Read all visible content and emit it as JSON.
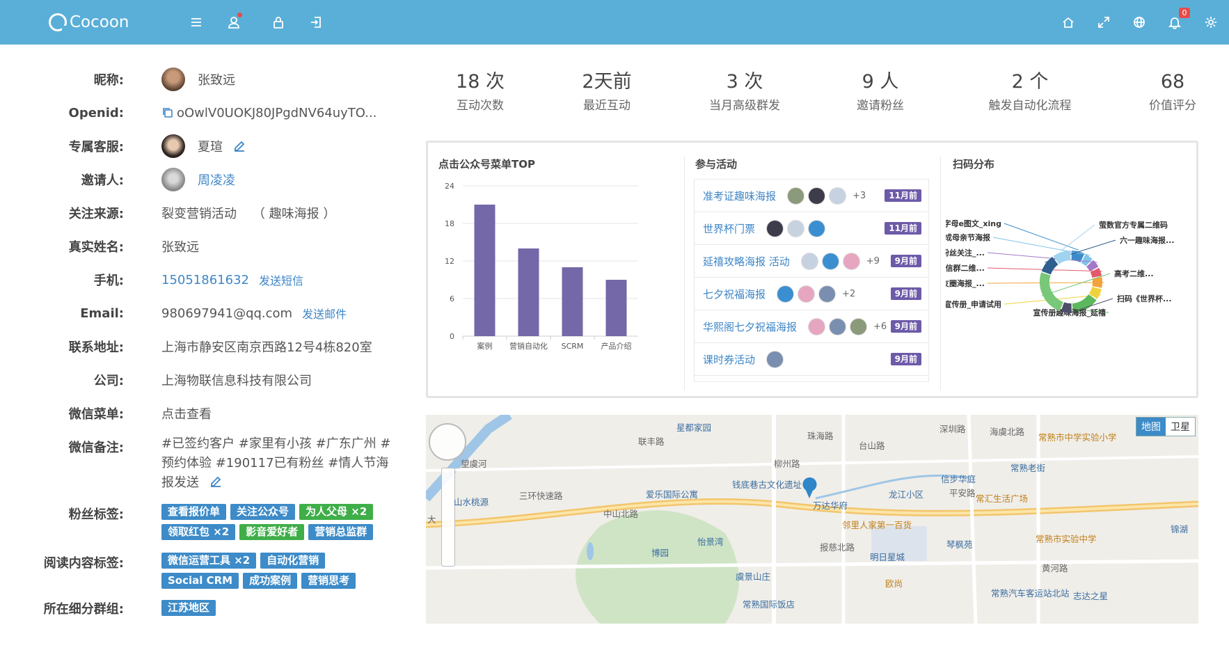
{
  "app": {
    "brand": "Cocoon",
    "notification_count": "0"
  },
  "topbar": {
    "left_icons": [
      "menu-icon",
      "user-icon",
      "lock-icon",
      "logout-icon"
    ],
    "right_icons": [
      "home-icon",
      "fullscreen-icon",
      "globe-icon",
      "bell-icon",
      "gear-icon"
    ],
    "accent": "#5aafd8"
  },
  "profile": {
    "nickname_label": "昵称:",
    "nickname": "张致远",
    "openid_label": "Openid:",
    "openid": "oOwlV0UOKJ80JPgdNV64uyTO...",
    "agent_label": "专属客服:",
    "agent": "夏瑄",
    "inviter_label": "邀请人:",
    "inviter": "周凌凌",
    "source_label": "关注来源:",
    "source": "裂变营销活动    （ 趣味海报 ）",
    "realname_label": "真实姓名:",
    "realname": "张致远",
    "phone_label": "手机:",
    "phone": "15051861632",
    "send_sms": "发送短信",
    "email_label": "Email:",
    "email": "980697941@qq.com",
    "send_mail": "发送邮件",
    "address_label": "联系地址:",
    "address": "上海市静安区南京西路12号4栋820室",
    "company_label": "公司:",
    "company": "上海物联信息科技有限公司",
    "wxmenu_label": "微信菜单:",
    "wxmenu": "点击查看",
    "wxnote_label": "微信备注:",
    "wxnote": "#已签约客户 #家里有小孩 #广东广州 #预约体验 #190117已有粉丝 #情人节海报发送",
    "fan_tags_label": "粉丝标签:",
    "fan_tags": [
      {
        "text": "查看报价单",
        "color": "blue"
      },
      {
        "text": "关注公众号",
        "color": "blue"
      },
      {
        "text": "为人父母  ×2",
        "color": "green"
      },
      {
        "text": "领取红包  ×2",
        "color": "blue"
      },
      {
        "text": "影音爱好者",
        "color": "green"
      },
      {
        "text": "营销总监群",
        "color": "blue"
      }
    ],
    "read_tags_label": "阅读内容标签:",
    "read_tags": [
      {
        "text": "微信运营工具  ×2",
        "color": "blue"
      },
      {
        "text": "自动化营销",
        "color": "blue"
      },
      {
        "text": "Social CRM",
        "color": "blue"
      },
      {
        "text": "成功案例",
        "color": "blue"
      },
      {
        "text": "营销思考",
        "color": "blue"
      }
    ],
    "segment_label": "所在细分群组:",
    "segments": [
      {
        "text": "江苏地区",
        "color": "blue"
      }
    ]
  },
  "stats": [
    {
      "value": "18 次",
      "caption": "互动次数"
    },
    {
      "value": "2天前",
      "caption": "最近互动"
    },
    {
      "value": "3 次",
      "caption": "当月高级群发"
    },
    {
      "value": "9 人",
      "caption": "邀请粉丝"
    },
    {
      "value": "2 个",
      "caption": "触发自动化流程"
    },
    {
      "value": "68",
      "caption": "价值评分"
    }
  ],
  "panel": {
    "menu_title": "点击公众号菜单TOP",
    "activity_title": "参与活动",
    "scan_title": "扫码分布"
  },
  "chart_data": [
    {
      "type": "bar",
      "title": "点击公众号菜单TOP",
      "categories": [
        "案例",
        "营销自动化",
        "SCRM",
        "产品介绍"
      ],
      "values": [
        21,
        14,
        11,
        9
      ],
      "ylim": [
        0,
        24
      ],
      "yticks": [
        0,
        6,
        12,
        18,
        24
      ],
      "xlabel": "",
      "ylabel": "",
      "grid": true,
      "color": "#7468a8"
    },
    {
      "type": "pie",
      "title": "扫码分布",
      "labels": [
        "海报字母e图文_xing",
        "生成母亲节海报",
        "新粉丝关注_...",
        "微信群二维...",
        "朋友圈海报_...",
        "萤宣传册_申请试用",
        "宣传册趣味海报_延禧",
        "扫码《世界杯...",
        "高考二维...",
        "六一趣味海报...",
        "萤数官方专属二维码"
      ],
      "values": [
        6,
        4,
        4,
        4,
        5,
        5,
        12,
        5,
        20,
        8,
        8
      ]
    }
  ],
  "activities": [
    {
      "name": "准考证趣味海报",
      "extra": "+3",
      "when": "11月前",
      "avatars": 3
    },
    {
      "name": "世界杯门票",
      "extra": "",
      "when": "11月前",
      "avatars": 3
    },
    {
      "name": "延禧攻略海报 活动",
      "extra": "+9",
      "when": "9月前",
      "avatars": 3
    },
    {
      "name": "七夕祝福海报",
      "extra": "+2",
      "when": "9月前",
      "avatars": 3
    },
    {
      "name": "华熙阁七夕祝福海报",
      "extra": "+6",
      "when": "9月前",
      "avatars": 3
    },
    {
      "name": "课时券活动",
      "extra": "",
      "when": "9月前",
      "avatars": 1
    }
  ],
  "map": {
    "toggle_map": "地图",
    "toggle_sat": "卫星",
    "labels": [
      {
        "t": "星都家园",
        "k": "poi"
      },
      {
        "t": "联丰路",
        "k": "road"
      },
      {
        "t": "珠海路",
        "k": "road"
      },
      {
        "t": "台山路",
        "k": "road"
      },
      {
        "t": "深圳路",
        "k": "road"
      },
      {
        "t": "海虞北路",
        "k": "road"
      },
      {
        "t": "常熟市中学实验小学",
        "k": "orange"
      },
      {
        "t": "常熟老街",
        "k": "poi"
      },
      {
        "t": "信步华庭",
        "k": "poi"
      },
      {
        "t": "平安路",
        "k": "road"
      },
      {
        "t": "常汇生活广场",
        "k": "orange"
      },
      {
        "t": "龙江小区",
        "k": "poi"
      },
      {
        "t": "万达华府",
        "k": "poi"
      },
      {
        "t": "钱底巷古文化遗址",
        "k": "poi"
      },
      {
        "t": "爱乐国际公寓",
        "k": "poi"
      },
      {
        "t": "三环快速路",
        "k": "road"
      },
      {
        "t": "中山北路",
        "k": "road"
      },
      {
        "t": "山水桃源",
        "k": "poi"
      },
      {
        "t": "望虞河",
        "k": "road"
      },
      {
        "t": "怡景湾",
        "k": "poi"
      },
      {
        "t": "博园",
        "k": "poi"
      },
      {
        "t": "邻里人家第一百货",
        "k": "orange"
      },
      {
        "t": "明日星城",
        "k": "poi"
      },
      {
        "t": "琴枫苑",
        "k": "poi"
      },
      {
        "t": "常熟市实验中学",
        "k": "orange"
      },
      {
        "t": "黄河路",
        "k": "road"
      },
      {
        "t": "虞景山庄",
        "k": "poi"
      },
      {
        "t": "欧尚",
        "k": "orange"
      },
      {
        "t": "常熟国际饭店",
        "k": "poi"
      },
      {
        "t": "常熟汽车客运站北站",
        "k": "poi"
      },
      {
        "t": "志达之星",
        "k": "poi"
      },
      {
        "t": "锦湖",
        "k": "poi"
      },
      {
        "t": "报慈北路",
        "k": "road"
      },
      {
        "t": "大",
        "k": "road"
      },
      {
        "t": "柳州路",
        "k": "road"
      }
    ]
  }
}
